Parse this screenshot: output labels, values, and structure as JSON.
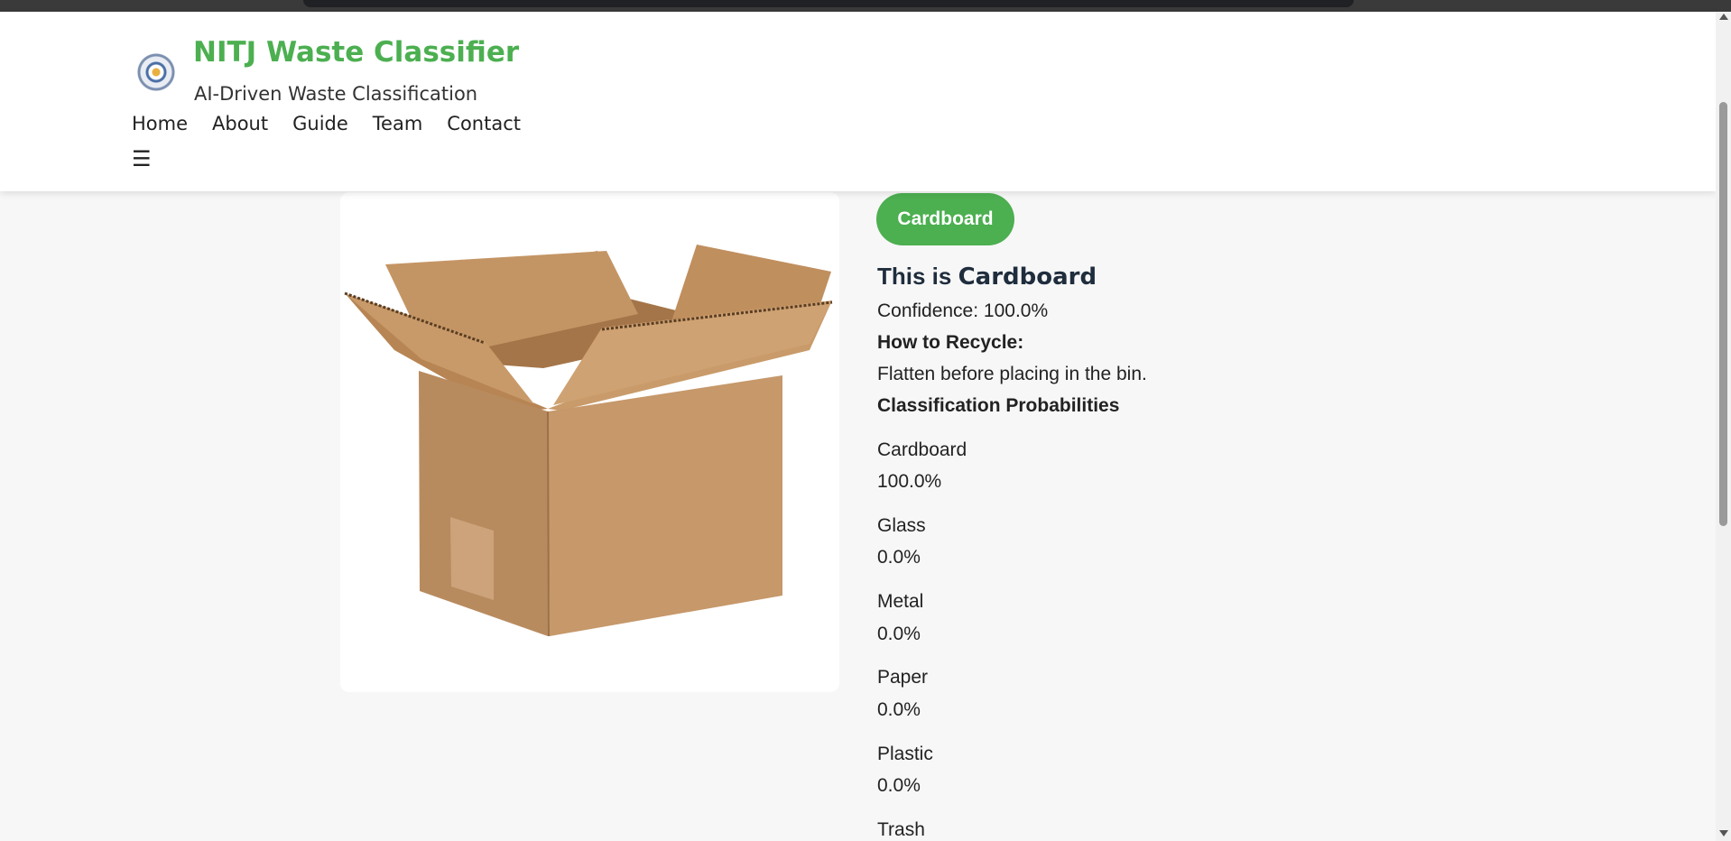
{
  "brand": {
    "title": "NITJ Waste Classifier",
    "subtitle": "AI-Driven Waste Classification",
    "logo_icon": "institute-seal-icon",
    "accent_color": "#4caf50"
  },
  "nav": {
    "items": [
      "Home",
      "About",
      "Guide",
      "Team",
      "Contact"
    ],
    "menu_icon": "☰"
  },
  "result": {
    "badge": "Cardboard",
    "headline_prefix": "This is ",
    "headline_class": "Cardboard",
    "confidence": "Confidence: 100.0%",
    "recycle_heading": "How to Recycle:",
    "recycle_tip": "Flatten before placing in the bin.",
    "prob_heading": "Classification Probabilities",
    "probabilities": [
      {
        "label": "Cardboard",
        "value": "100.0%"
      },
      {
        "label": "Glass",
        "value": "0.0%"
      },
      {
        "label": "Metal",
        "value": "0.0%"
      },
      {
        "label": "Paper",
        "value": "0.0%"
      },
      {
        "label": "Plastic",
        "value": "0.0%"
      },
      {
        "label": "Trash",
        "value": ""
      }
    ]
  },
  "image": {
    "subject_icon": "cardboard-box-image"
  }
}
